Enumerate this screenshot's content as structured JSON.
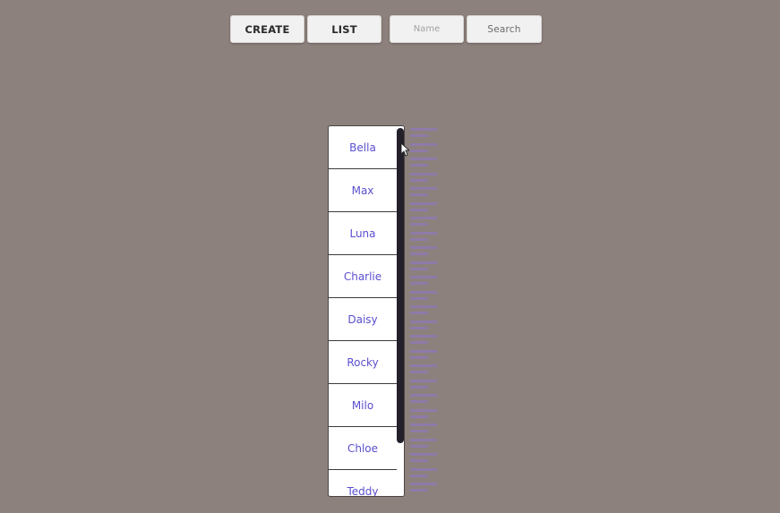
{
  "toolbar": {
    "create_label": "CREATE",
    "list_label": "LIST",
    "name_placeholder": "Name",
    "name_value": "",
    "search_label": "Search"
  },
  "list": {
    "items": [
      {
        "label": "Bella"
      },
      {
        "label": "Max"
      },
      {
        "label": "Luna"
      },
      {
        "label": "Charlie"
      },
      {
        "label": "Daisy"
      },
      {
        "label": "Rocky"
      },
      {
        "label": "Milo"
      },
      {
        "label": "Chloe"
      },
      {
        "label": "Teddy"
      }
    ]
  },
  "id_strip": {
    "entry_count": 25
  },
  "colors": {
    "background": "#8d817d",
    "button_bg": "#f2f1f1",
    "list_text": "#5a4fcf",
    "scroll_thumb": "#24202a",
    "id_dash": "#8f79b0"
  }
}
